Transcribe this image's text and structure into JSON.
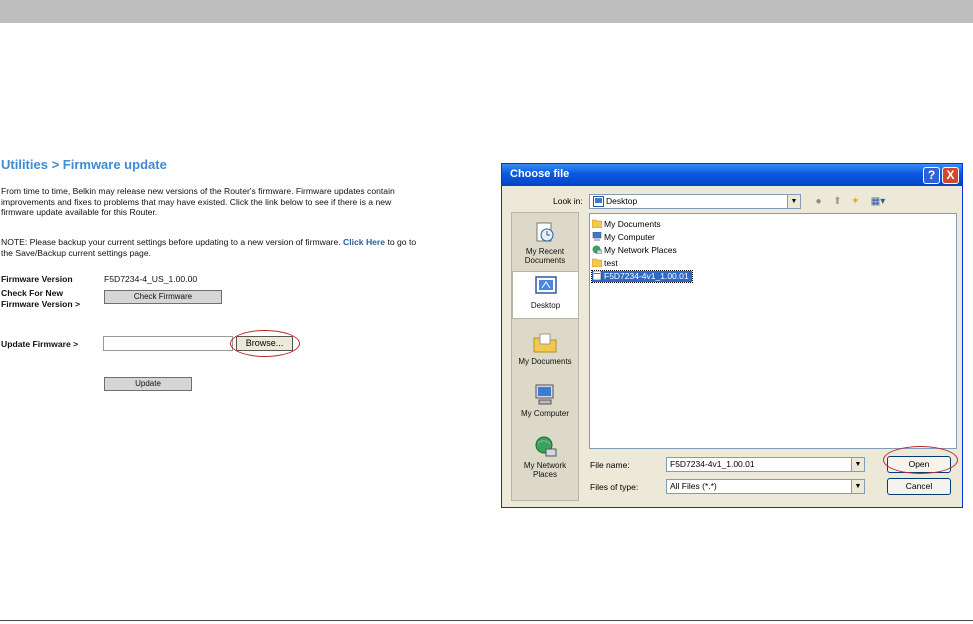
{
  "page": {
    "title": "Utilities > Firmware update",
    "para1_lines": [
      "From time to time, Belkin may release new versions of the Router's firmware. Firmware updates contain",
      "improvements and fixes to problems that may have existed. Click the link below to see if there is a new",
      "firmware update available for this Router."
    ],
    "note_line1_pre": "NOTE: Please backup your current settings before updating to a new version of firmware. ",
    "note_link": "Click Here",
    "note_line1_post": " to go to",
    "note_line2": "the Save/Backup current settings page.",
    "firmware_version_label": "Firmware Version",
    "firmware_version_value": "F5D7234-4_US_1.00.00",
    "check_new_label_line1": "Check For New",
    "check_new_label_line2": "Firmware Version >",
    "check_firmware_button": "Check Firmware",
    "update_firmware_label": "Update Firmware >",
    "update_firmware_input_value": "",
    "browse_button": "Browse...",
    "update_button": "Update",
    "highlight_color": "#c0282d"
  },
  "dialog": {
    "title": "Choose file",
    "help": "?",
    "close": "X",
    "look_in_label": "Look in:",
    "look_in_value": "Desktop",
    "places": [
      {
        "label": "My Recent Documents",
        "icon": "recent-documents-icon"
      },
      {
        "label": "Desktop",
        "icon": "desktop-icon"
      },
      {
        "label": "My Documents",
        "icon": "my-documents-icon"
      },
      {
        "label": "My Computer",
        "icon": "my-computer-icon"
      },
      {
        "label": "My Network Places",
        "icon": "network-places-icon"
      }
    ],
    "files": [
      {
        "name": "My Documents",
        "icon": "folder-icon"
      },
      {
        "name": "My Computer",
        "icon": "computer-icon"
      },
      {
        "name": "My Network Places",
        "icon": "network-icon"
      },
      {
        "name": "test",
        "icon": "folder-icon"
      },
      {
        "name": "F5D7234-4v1_1.00.01",
        "icon": "file-icon",
        "selected": true
      }
    ],
    "file_name_label": "File name:",
    "file_name_value": "F5D7234-4v1_1.00.01",
    "files_of_type_label": "Files of type:",
    "files_of_type_value": "All Files (*.*)",
    "open_button": "Open",
    "cancel_button": "Cancel",
    "title_bar_color": "#0a58e0"
  }
}
